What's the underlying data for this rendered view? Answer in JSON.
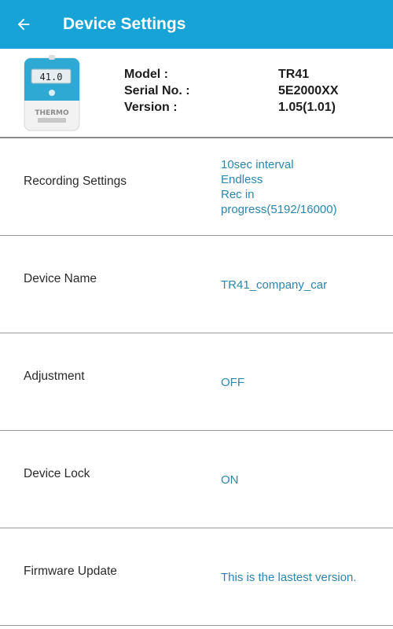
{
  "header": {
    "title": "Device Settings",
    "back_icon": "arrow-left-icon",
    "background": "#17a3d6"
  },
  "device": {
    "image_display_reading": "41.0",
    "image_brand_text": "THERMO",
    "model_label": "Model :",
    "model_value": "TR41",
    "serial_label": "Serial No. :",
    "serial_value": "5E2000XX",
    "version_label": "Version :",
    "version_value": "1.05(1.01)"
  },
  "settings": [
    {
      "label": "Recording Settings",
      "value_lines": [
        "10sec interval",
        "Endless",
        "Rec in",
        "progress(5192/16000)"
      ]
    },
    {
      "label": "Device Name",
      "value_lines": [
        "TR41_company_car"
      ]
    },
    {
      "label": "Adjustment",
      "value_lines": [
        "OFF"
      ]
    },
    {
      "label": "Device Lock",
      "value_lines": [
        "ON"
      ]
    },
    {
      "label": "Firmware Update",
      "value_lines": [
        "This is the lastest version."
      ]
    }
  ],
  "colors": {
    "accent": "#17a3d6",
    "value_text": "#2c86ad"
  }
}
